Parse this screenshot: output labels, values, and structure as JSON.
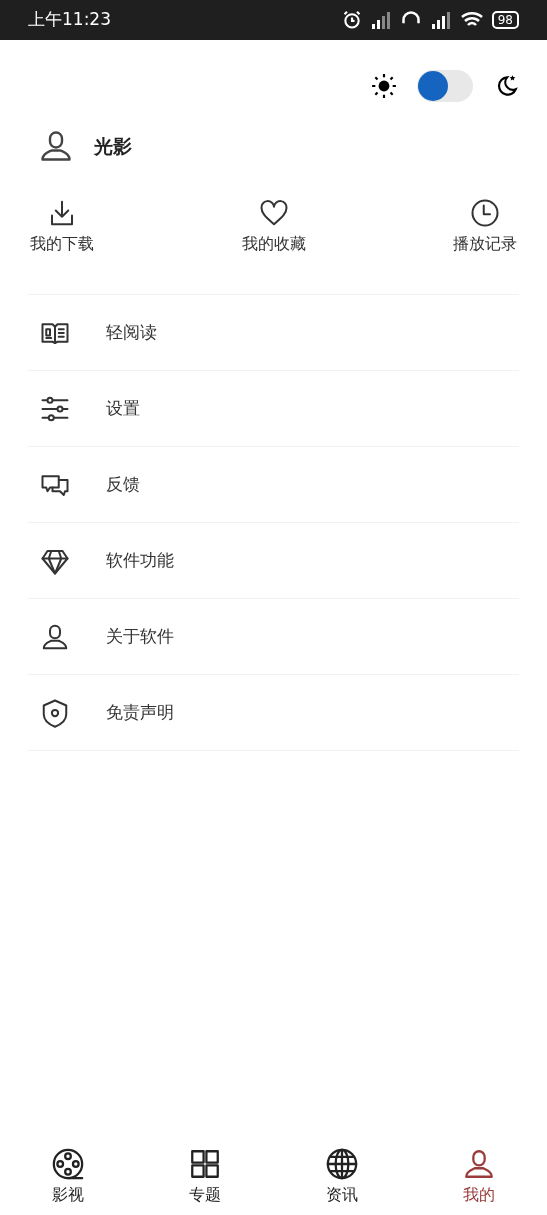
{
  "status_bar": {
    "time": "上午11:23",
    "battery": "98"
  },
  "theme_toggle": {
    "dark": false
  },
  "user": {
    "name": "光影"
  },
  "quick_actions": [
    {
      "kind": "download",
      "label": "我的下载"
    },
    {
      "kind": "favorite",
      "label": "我的收藏"
    },
    {
      "kind": "history",
      "label": "播放记录"
    }
  ],
  "menu": [
    {
      "kind": "read",
      "label": "轻阅读"
    },
    {
      "kind": "settings",
      "label": "设置"
    },
    {
      "kind": "feedback",
      "label": "反馈"
    },
    {
      "kind": "features",
      "label": "软件功能"
    },
    {
      "kind": "about",
      "label": "关于软件"
    },
    {
      "kind": "disclaimer",
      "label": "免责声明"
    }
  ],
  "bottom_nav": [
    {
      "kind": "film",
      "label": "影视",
      "selected": false
    },
    {
      "kind": "topics",
      "label": "专题",
      "selected": false
    },
    {
      "kind": "news",
      "label": "资讯",
      "selected": false
    },
    {
      "kind": "me",
      "label": "我的",
      "selected": true
    }
  ]
}
